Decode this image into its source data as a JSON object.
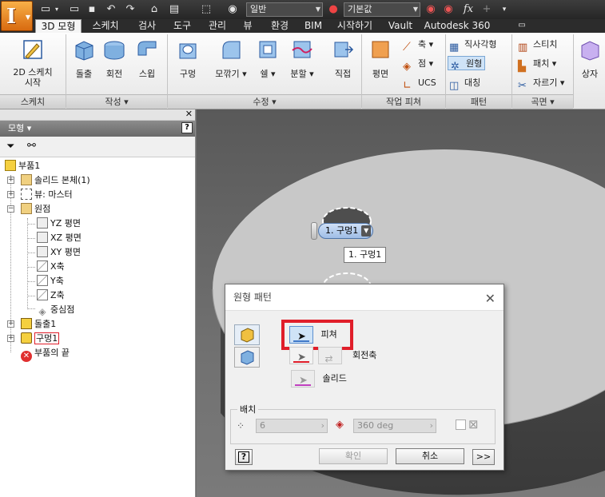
{
  "quick_access": {
    "appearance_combo": "일반",
    "material_combo": "기본값",
    "fx_label": "fx"
  },
  "tabs": [
    {
      "label": "3D 모형",
      "active": true
    },
    {
      "label": "스케치"
    },
    {
      "label": "검사"
    },
    {
      "label": "도구"
    },
    {
      "label": "관리"
    },
    {
      "label": "뷰"
    },
    {
      "label": "환경"
    },
    {
      "label": "BIM"
    },
    {
      "label": "시작하기"
    },
    {
      "label": "Vault"
    },
    {
      "label": "Autodesk 360"
    }
  ],
  "ribbon": {
    "sketch_panel": {
      "start_sketch": "2D 스케치\n시작",
      "label": "스케치"
    },
    "create_panel": {
      "extrude": "돌출",
      "revolve": "회전",
      "sweep": "스윕",
      "label": "작성 ▾"
    },
    "modify_panel": {
      "hole": "구멍",
      "fillet": "모깎기 ▾",
      "shell": "쉘 ▾",
      "split": "분할 ▾",
      "label": "수정 ▾",
      "direct": "직접"
    },
    "work_features_panel": {
      "plane": "평면",
      "axis": "축 ▾",
      "point": "점 ▾",
      "ucs": "UCS",
      "label": "작업 피쳐"
    },
    "pattern_panel": {
      "rectangular": "직사각형",
      "circular": "원형",
      "mirror": "대칭",
      "label": "패턴"
    },
    "surface_panel": {
      "stitch": "스티치",
      "patch": "패치 ▾",
      "trim": "자르기 ▾",
      "label": "곡면 ▾"
    },
    "extra": {
      "box": "상자"
    }
  },
  "browser": {
    "header": "모형 ▾",
    "help": "?",
    "tree": [
      {
        "label": "부품1",
        "level": 0
      },
      {
        "label": "솔리드 본체(1)",
        "level": 1,
        "expander": "+"
      },
      {
        "label": "뷰: 마스터",
        "level": 1,
        "expander": "+"
      },
      {
        "label": "원점",
        "level": 1,
        "expander": "-"
      },
      {
        "label": "YZ 평면",
        "level": 2
      },
      {
        "label": "XZ 평면",
        "level": 2
      },
      {
        "label": "XY 평면",
        "level": 2
      },
      {
        "label": "X축",
        "level": 2
      },
      {
        "label": "Y축",
        "level": 2
      },
      {
        "label": "Z축",
        "level": 2
      },
      {
        "label": "중심점",
        "level": 2
      },
      {
        "label": "돌출1",
        "level": 1,
        "expander": "+"
      },
      {
        "label": "구멍1",
        "level": 1,
        "expander": "+",
        "highlight": true
      },
      {
        "label": "부품의 끝",
        "level": 1
      }
    ]
  },
  "viewport": {
    "feature_tag": "1. 구멍1",
    "feature_tooltip": "1. 구멍1"
  },
  "dialog": {
    "title": "원형 패턴",
    "features_label": "피쳐",
    "rotation_axis_label": "회전축",
    "solid_label": "솔리드",
    "placement_legend": "배치",
    "count": "6",
    "angle": "360 deg",
    "ok": "확인",
    "cancel": "취소",
    "more": ">>",
    "help": "?"
  },
  "colors": {
    "highlight_red": "#e01e2a",
    "accent_blue": "#3f78c8",
    "viewport_bg": "#6a6a6a"
  }
}
